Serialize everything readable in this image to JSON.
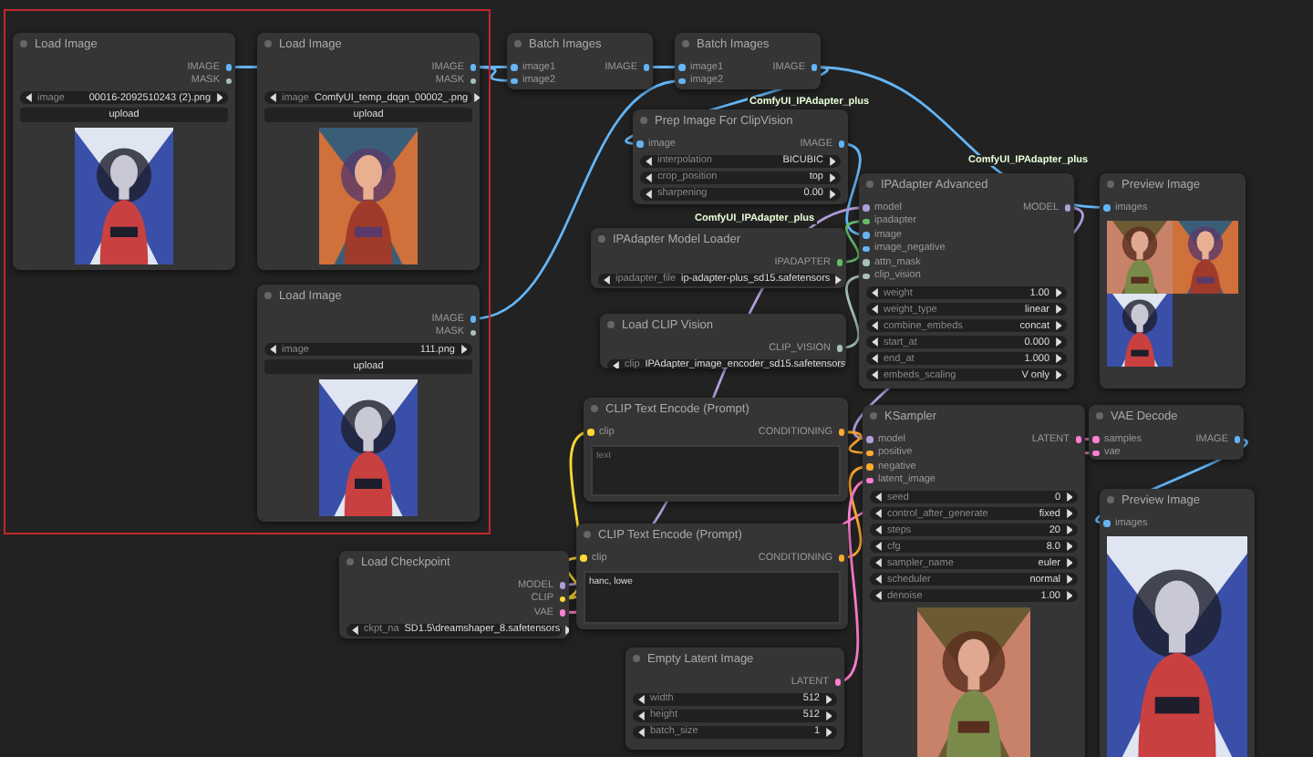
{
  "selection_frame": true,
  "link_labels": [
    "ComfyUI_IPAdapter_plus",
    "ComfyUI_IPAdapter_plus",
    "ComfyUI_IPAdapter_plus"
  ],
  "nodes": [
    {
      "title": "Load Image",
      "outputs": [
        {
          "label": "IMAGE"
        },
        {
          "label": "MASK",
          "kind": "mask"
        }
      ],
      "widgets": [
        {
          "name": "image",
          "value": "00016-2092510243 (2).png"
        }
      ],
      "button": "upload",
      "pictures": [
        {
          "kind": "picture"
        }
      ]
    },
    {
      "title": "Load Image",
      "outputs": [
        {
          "label": "IMAGE"
        },
        {
          "label": "MASK",
          "kind": "mask"
        }
      ],
      "widgets": [
        {
          "name": "image",
          "value": "ComfyUI_temp_dqgn_00002_.png"
        }
      ],
      "button": "upload",
      "pictures": [
        {
          "kind": "picture"
        }
      ]
    },
    {
      "title": "Batch Images",
      "inputs": [
        {
          "label": "image1"
        },
        {
          "label": "image2"
        }
      ],
      "outputs": [
        {
          "label": "IMAGE"
        }
      ]
    },
    {
      "title": "Batch Images",
      "inputs": [
        {
          "label": "image1"
        },
        {
          "label": "image2"
        }
      ],
      "outputs": [
        {
          "label": "IMAGE"
        }
      ]
    },
    {
      "title": "Prep Image For ClipVision",
      "inputs": [
        {
          "label": "image"
        }
      ],
      "outputs": [
        {
          "label": "IMAGE"
        }
      ],
      "widgets": [
        {
          "name": "interpolation",
          "value": "BICUBIC"
        },
        {
          "name": "crop_position",
          "value": "top"
        },
        {
          "name": "sharpening",
          "value": "0.00"
        }
      ]
    },
    {
      "title": "IPAdapter Advanced",
      "inputs": [
        {
          "label": "model",
          "kind": "model"
        },
        {
          "label": "ipadapter",
          "kind": "ipadapter"
        },
        {
          "label": "image"
        },
        {
          "label": "image_negative"
        },
        {
          "label": "attn_mask",
          "kind": "mask"
        },
        {
          "label": "clip_vision",
          "kind": "mask"
        }
      ],
      "outputs": [
        {
          "label": "MODEL",
          "kind": "model"
        }
      ],
      "widgets": [
        {
          "name": "weight",
          "value": "1.00"
        },
        {
          "name": "weight_type",
          "value": "linear"
        },
        {
          "name": "combine_embeds",
          "value": "concat"
        },
        {
          "name": "start_at",
          "value": "0.000"
        },
        {
          "name": "end_at",
          "value": "1.000"
        },
        {
          "name": "embeds_scaling",
          "value": "V only"
        }
      ]
    },
    {
      "title": "Preview Image",
      "inputs": [
        {
          "label": "images"
        }
      ],
      "pictures": [
        {
          "kind": "picture"
        },
        {
          "kind": "picture"
        },
        {
          "kind": "picture"
        }
      ]
    },
    {
      "title": "IPAdapter Model Loader",
      "outputs": [
        {
          "label": "IPADAPTER",
          "kind": "ipadapter"
        }
      ],
      "widgets": [
        {
          "name": "ipadapter_file",
          "value": "ip-adapter-plus_sd15.safetensors"
        }
      ]
    },
    {
      "title": "Load Image",
      "outputs": [
        {
          "label": "IMAGE"
        },
        {
          "label": "MASK",
          "kind": "mask"
        }
      ],
      "widgets": [
        {
          "name": "image",
          "value": "111.png"
        }
      ],
      "button": "upload",
      "pictures": [
        {
          "kind": "picture"
        }
      ]
    },
    {
      "title": "Load CLIP Vision",
      "outputs": [
        {
          "label": "CLIP_VISION",
          "kind": "mask"
        }
      ],
      "widgets": [
        {
          "name": "clip",
          "value": "IPAdapter_image_encoder_sd15.safetensors"
        }
      ]
    },
    {
      "title": "CLIP Text Encode (Prompt)",
      "inputs": [
        {
          "label": "clip",
          "kind": "clip"
        }
      ],
      "outputs": [
        {
          "label": "CONDITIONING",
          "kind": "conditioning"
        }
      ],
      "textarea": {
        "placeholder": "text"
      }
    },
    {
      "title": "CLIP Text Encode (Prompt)",
      "inputs": [
        {
          "label": "clip",
          "kind": "clip"
        }
      ],
      "outputs": [
        {
          "label": "CONDITIONING",
          "kind": "conditioning"
        }
      ],
      "textarea": {
        "value": "hanc, lowe"
      }
    },
    {
      "title": "Load Checkpoint",
      "outputs": [
        {
          "label": "MODEL",
          "kind": "model"
        },
        {
          "label": "CLIP",
          "kind": "clip"
        },
        {
          "label": "VAE",
          "kind": "latent"
        }
      ],
      "widgets": [
        {
          "name": "ckpt_na",
          "value": "SD1.5\\dreamshaper_8.safetensors"
        }
      ]
    },
    {
      "title": "Empty Latent Image",
      "outputs": [
        {
          "label": "LATENT",
          "kind": "latent"
        }
      ],
      "widgets": [
        {
          "name": "width",
          "value": "512"
        },
        {
          "name": "height",
          "value": "512"
        },
        {
          "name": "batch_size",
          "value": "1"
        }
      ]
    },
    {
      "title": "KSampler",
      "inputs": [
        {
          "label": "model",
          "kind": "model"
        },
        {
          "label": "positive",
          "kind": "conditioning"
        },
        {
          "label": "negative",
          "kind": "conditioning"
        },
        {
          "label": "latent_image",
          "kind": "latent"
        }
      ],
      "outputs": [
        {
          "label": "LATENT",
          "kind": "latent"
        }
      ],
      "widgets": [
        {
          "name": "seed",
          "value": "0"
        },
        {
          "name": "control_after_generate",
          "value": "fixed"
        },
        {
          "name": "steps",
          "value": "20"
        },
        {
          "name": "cfg",
          "value": "8.0"
        },
        {
          "name": "sampler_name",
          "value": "euler"
        },
        {
          "name": "scheduler",
          "value": "normal"
        },
        {
          "name": "denoise",
          "value": "1.00"
        }
      ],
      "pictures": [
        {
          "kind": "picture"
        }
      ]
    },
    {
      "title": "VAE Decode",
      "inputs": [
        {
          "label": "samples",
          "kind": "latent"
        },
        {
          "label": "vae",
          "kind": "latent"
        }
      ],
      "outputs": [
        {
          "label": "IMAGE"
        }
      ]
    },
    {
      "title": "Preview Image",
      "inputs": [
        {
          "label": "images"
        }
      ],
      "pictures": [
        {
          "kind": "picture"
        }
      ]
    }
  ]
}
